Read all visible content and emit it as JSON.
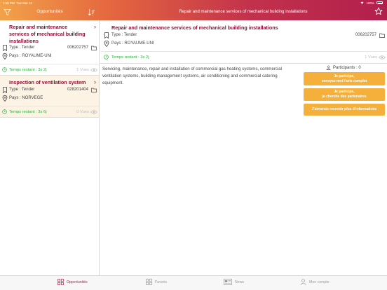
{
  "status_bar": {
    "time": "1:58 PM",
    "date": "Tue Mar 10",
    "battery": "100%"
  },
  "left_header": {
    "title": "Opportunités"
  },
  "right_header": {
    "title": "Repair and maintenance services of mechanical building installations"
  },
  "opportunities": [
    {
      "title": "Repair and maintenance services of mechanical building installations",
      "type_label": "Type : Tender",
      "reference": "006202757",
      "country_label": "Pays : ROYAUME-UNI",
      "time_left": "Temps restant : 3s 2j",
      "views": "1 Vues",
      "selected": false
    },
    {
      "title": "Inspection of ventilation system",
      "type_label": "Type : Tender",
      "reference": "028201404",
      "country_label": "Pays : NORVEGE",
      "time_left": "Temps restant : 3s 6j",
      "views": "0 Vues",
      "selected": true
    }
  ],
  "detail": {
    "title": "Repair and maintenance services of mechanical building installations",
    "type_label": "Type : Tender",
    "reference": "006202757",
    "country_label": "Pays : ROYAUME-UNI",
    "time_left": "Temps restant : 3s 2j",
    "views": "1 Vues",
    "description": "Servicing, maintenance, repair and installation of commercial gas heating systems, commercial ventilation systems, building management systems, air conditioning and commercial catering equipment.",
    "participants_label": "Participants : 0",
    "buttons": [
      {
        "line1": "Je participe,",
        "line2": "envoyez-moi l'avis complet"
      },
      {
        "line1": "Je participe,",
        "line2": "je cherche des partenaires"
      },
      {
        "line1": "J'aimerais recevoir plus d'informations",
        "line2": ""
      }
    ]
  },
  "tabs": [
    {
      "label": "Opportunités",
      "icon": "grid-icon",
      "active": true
    },
    {
      "label": "Favoris",
      "icon": "grid-icon",
      "active": false
    },
    {
      "label": "News",
      "icon": "newspaper-icon",
      "active": false
    },
    {
      "label": "Mon compte",
      "icon": "user-icon",
      "active": false
    }
  ],
  "colors": {
    "accent": "#8e1038",
    "header_start": "#f2a24a",
    "header_end": "#b21f4c",
    "green": "#27b43b",
    "button": "#f5b03b",
    "selected_bg": "#fdf3e4"
  }
}
